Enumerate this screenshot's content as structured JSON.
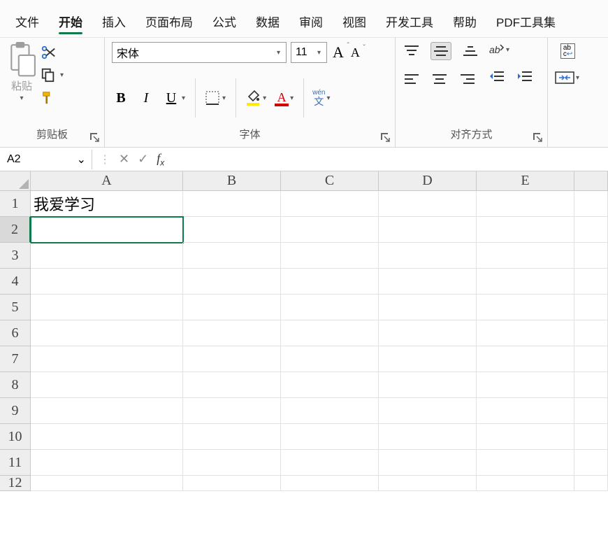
{
  "tabs": [
    "文件",
    "开始",
    "插入",
    "页面布局",
    "公式",
    "数据",
    "审阅",
    "视图",
    "开发工具",
    "帮助",
    "PDF工具集"
  ],
  "activeTab": 1,
  "clipboard": {
    "paste": "粘贴",
    "groupLabel": "剪贴板"
  },
  "font": {
    "name": "宋体",
    "size": "11",
    "groupLabel": "字体",
    "bold": "B",
    "italic": "I",
    "underline": "U",
    "phonetic_top": "wén",
    "phonetic_bottom": "文"
  },
  "align": {
    "groupLabel": "对齐方式"
  },
  "wrap": {
    "top": "ab",
    "bottom": "c"
  },
  "namebox": "A2",
  "formula": "",
  "columns": [
    "A",
    "B",
    "C",
    "D",
    "E",
    ""
  ],
  "rows": [
    "1",
    "2",
    "3",
    "4",
    "5",
    "6",
    "7",
    "8",
    "9",
    "10",
    "11",
    "12"
  ],
  "selectedRow": 1,
  "cells": {
    "A1": "我爱学习"
  }
}
